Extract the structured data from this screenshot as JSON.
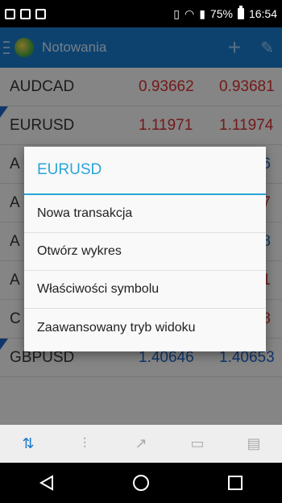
{
  "status_bar": {
    "battery": "75%",
    "time": "16:54",
    "icons": [
      "image-icon",
      "calendar-icon",
      "clipboard-icon",
      "vibrate-icon",
      "wifi-icon",
      "signal-icon",
      "battery-icon"
    ]
  },
  "action_bar": {
    "title": "Notowania",
    "icons": [
      "menu-icon",
      "app-logo-icon",
      "add-icon",
      "edit-icon"
    ]
  },
  "quotes": [
    {
      "symbol": "AUDCAD",
      "bid": "0.93662",
      "ask": "0.93681",
      "color": "red",
      "marked": false
    },
    {
      "symbol": "EURUSD",
      "bid": "1.11971",
      "ask": "1.11974",
      "color": "red",
      "marked": true
    },
    {
      "symbol": "A",
      "bid": "",
      "ask": "6",
      "color": "blue",
      "marked": false
    },
    {
      "symbol": "A",
      "bid": "",
      "ask": "7",
      "color": "red",
      "marked": false
    },
    {
      "symbol": "A",
      "bid": "",
      "ask": "8",
      "color": "blue",
      "marked": false
    },
    {
      "symbol": "A",
      "bid": "",
      "ask": "1",
      "color": "red",
      "marked": false
    },
    {
      "symbol": "C",
      "bid": "",
      "ask": "8",
      "color": "red",
      "marked": false
    },
    {
      "symbol": "GBPUSD",
      "bid": "1.40646",
      "ask": "1.40653",
      "color": "blue",
      "marked": true
    }
  ],
  "dialog": {
    "title": "EURUSD",
    "items": [
      {
        "label": "Nowa transakcja"
      },
      {
        "label": "Otwórz wykres"
      },
      {
        "label": "Właściwości symbolu"
      },
      {
        "label": "Zaawansowany tryb widoku"
      }
    ]
  },
  "tabs": [
    {
      "icon": "quotes-icon",
      "active": true
    },
    {
      "icon": "chart-icon",
      "active": false
    },
    {
      "icon": "trade-icon",
      "active": false
    },
    {
      "icon": "history-icon",
      "active": false
    },
    {
      "icon": "news-icon",
      "active": false
    }
  ],
  "nav": [
    "back-icon",
    "home-icon",
    "recents-icon"
  ],
  "colors": {
    "accent": "#1b79c9",
    "dialog_title": "#29a5d8",
    "bid_red": "#d32f2f",
    "bid_blue": "#1e62c3"
  }
}
